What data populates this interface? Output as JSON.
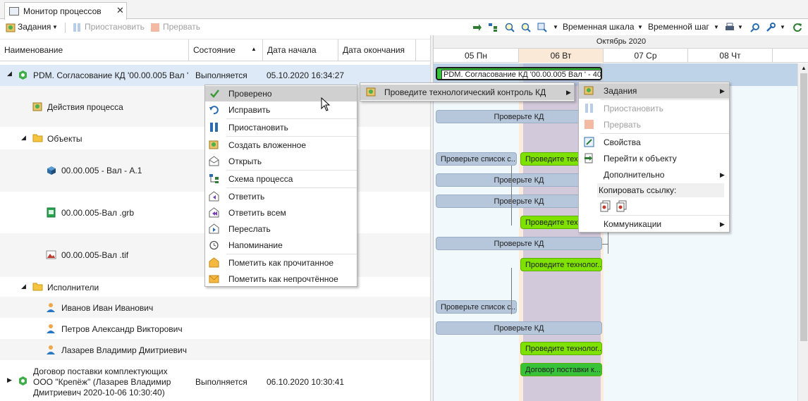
{
  "window": {
    "tab_title": "Монитор процессов",
    "tab_close": "✕"
  },
  "toolbar": {
    "tasks": "Задания",
    "suspend": "Приостановить",
    "abort": "Прервать",
    "timescale": "Временная шкала",
    "timestep": "Временной шаг"
  },
  "grid": {
    "columns": [
      "Наименование",
      "Состояние",
      "Дата начала",
      "Дата окончания"
    ],
    "rows": [
      {
        "name": "PDM. Согласование КД '00.00.005 Вал '",
        "state": "Выполняется",
        "start": "05.10.2020 16:34:27"
      },
      {
        "name": "Действия процесса"
      },
      {
        "name": "Объекты"
      },
      {
        "name": "00.00.005 - Вал  - А.1"
      },
      {
        "name": "00.00.005-Вал .grb"
      },
      {
        "name": "00.00.005-Вал .tif"
      },
      {
        "name": "Исполнители"
      },
      {
        "name": "Иванов Иван Иванович"
      },
      {
        "name": "Петров Александр Викторович"
      },
      {
        "name": "Лазарев Владимир Дмитриевич"
      },
      {
        "name_lines": [
          "Договор поставки комплектующих",
          "ООО \"Крепёж\" (Лазарев Владимир",
          "Дмитриевич 2020-10-06 10:30:40)"
        ],
        "state": "Выполняется",
        "start": "06.10.2020 10:30:41"
      }
    ]
  },
  "gantt": {
    "month": "Октябрь 2020",
    "days": [
      "05 Пн",
      "06 Вт",
      "07 Ср",
      "08 Чт"
    ],
    "bars": {
      "main": "PDM. Согласование КД '00.00.005 Вал ' - 40%",
      "check_kd": "Проверьте КД",
      "check_list": "Проверьте список с...",
      "tech_control": "Проведите техн...",
      "tech_control_long": "Проведите технолог...",
      "contract": "Договор поставки к..."
    }
  },
  "context_menu": {
    "items": [
      "Проверено",
      "Исправить",
      "Приостановить",
      "Создать вложенное",
      "Открыть",
      "Схема процесса",
      "Ответить",
      "Ответить всем",
      "Переслать",
      "Напоминание",
      "Пометить как прочитанное",
      "Пометить как непрочтённое"
    ]
  },
  "submenu1": {
    "item": "Проведите технологический контроль КД"
  },
  "submenu2": {
    "items": [
      "Задания",
      "Приостановить",
      "Прервать",
      "Свойства",
      "Перейти к объекту",
      "Дополнительно"
    ],
    "copy_link_label": "Копировать ссылку:",
    "communications": "Коммуникации"
  }
}
